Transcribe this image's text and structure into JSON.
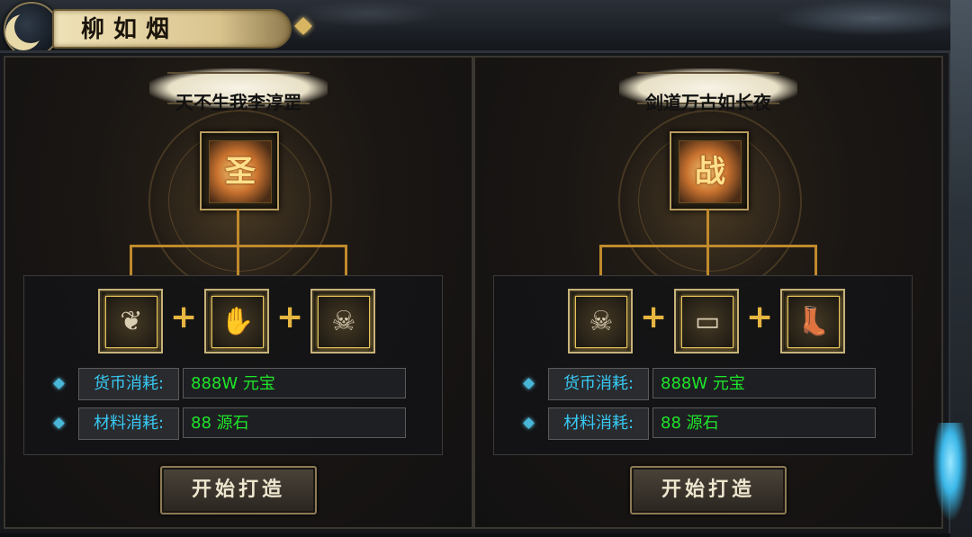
{
  "header": {
    "title": "柳如烟"
  },
  "top_hint": "",
  "recipes": [
    {
      "name": "天不生我李淳罡",
      "target_glyph": "圣",
      "materials": [
        {
          "icon": "amulet-icon",
          "glyph": "❦"
        },
        {
          "icon": "gauntlet-icon",
          "glyph": "✋"
        },
        {
          "icon": "skull-ring-icon",
          "glyph": "☠"
        }
      ],
      "currency_label": "货币消耗:",
      "currency_value": "888W 元宝",
      "material_label": "材料消耗:",
      "material_value": "88 源石",
      "button_label": "开始打造"
    },
    {
      "name": "剑道万古如长夜",
      "target_glyph": "战",
      "materials": [
        {
          "icon": "skull-helm-icon",
          "glyph": "☠"
        },
        {
          "icon": "belt-icon",
          "glyph": "▭"
        },
        {
          "icon": "boots-icon",
          "glyph": "👢"
        }
      ],
      "currency_label": "货币消耗:",
      "currency_value": "888W 元宝",
      "material_label": "材料消耗:",
      "material_value": "88  源石",
      "button_label": "开始打造"
    }
  ],
  "colors": {
    "label_text": "#37c9f4",
    "value_text": "#1ee62a",
    "connector": "#c08a2c",
    "plus": "#e7b640"
  }
}
